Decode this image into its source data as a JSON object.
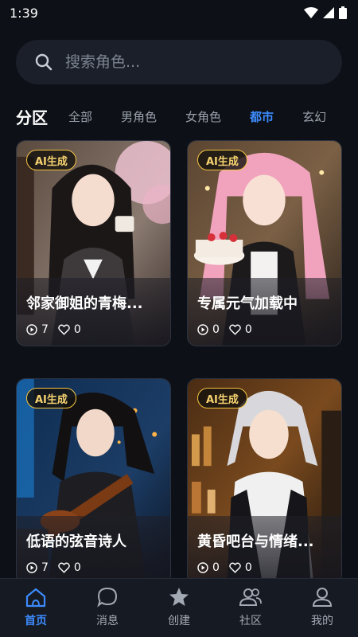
{
  "status_bar": {
    "time": "1:39"
  },
  "search": {
    "placeholder": "搜索角色..."
  },
  "section": {
    "title": "分区",
    "tabs": [
      {
        "label": "全部",
        "active": false
      },
      {
        "label": "男角色",
        "active": false
      },
      {
        "label": "女角色",
        "active": false
      },
      {
        "label": "都市",
        "active": true
      },
      {
        "label": "玄幻",
        "active": false
      }
    ]
  },
  "cards": [
    {
      "badge": "AI生成",
      "title": "邻家御姐的青梅...",
      "plays": "7",
      "likes": "0"
    },
    {
      "badge": "AI生成",
      "title": "专属元气加载中",
      "plays": "0",
      "likes": "0"
    },
    {
      "badge": "AI生成",
      "title": "低语的弦音诗人",
      "plays": "7",
      "likes": "0"
    },
    {
      "badge": "AI生成",
      "title": "黄昏吧台与情绪...",
      "plays": "0",
      "likes": "0"
    }
  ],
  "tabbar": {
    "items": [
      {
        "label": "首页",
        "icon": "home-icon",
        "active": true
      },
      {
        "label": "消息",
        "icon": "chat-bubble-icon",
        "active": false
      },
      {
        "label": "创建",
        "icon": "star-icon",
        "active": false
      },
      {
        "label": "社区",
        "icon": "community-icon",
        "active": false
      },
      {
        "label": "我的",
        "icon": "user-icon",
        "active": false
      }
    ]
  },
  "colors": {
    "background": "#0d1117",
    "accent": "#3d8bfd",
    "badge_gold": "#f5c542",
    "tab_inactive": "#9aa0ab"
  }
}
